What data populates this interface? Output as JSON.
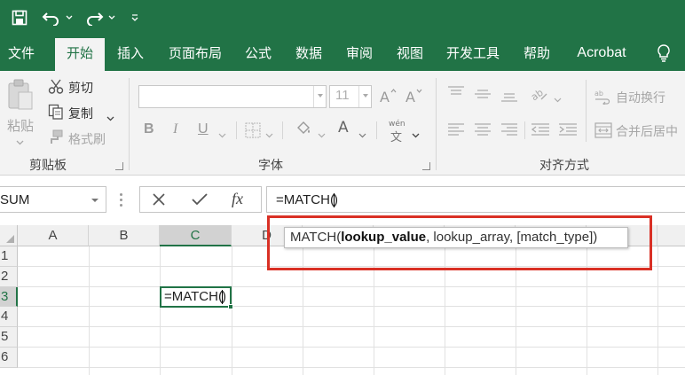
{
  "quick_access": {
    "save": "save-icon",
    "undo": "undo-icon",
    "redo": "redo-icon",
    "customize": "customize-icon"
  },
  "tabs": [
    {
      "label": "文件",
      "active": false
    },
    {
      "label": "开始",
      "active": true
    },
    {
      "label": "插入",
      "active": false
    },
    {
      "label": "页面布局",
      "active": false
    },
    {
      "label": "公式",
      "active": false
    },
    {
      "label": "数据",
      "active": false
    },
    {
      "label": "审阅",
      "active": false
    },
    {
      "label": "视图",
      "active": false
    },
    {
      "label": "开发工具",
      "active": false
    },
    {
      "label": "帮助",
      "active": false
    },
    {
      "label": "Acrobat",
      "active": false
    }
  ],
  "tell_me_icon": "lightbulb-icon",
  "clipboard": {
    "paste_label": "粘贴",
    "cut_label": "剪切",
    "copy_label": "复制",
    "format_painter_label": "格式刷",
    "group_label": "剪贴板"
  },
  "font": {
    "font_name": "",
    "font_size": "11",
    "bold": "B",
    "italic": "I",
    "underline": "U",
    "font_color_letter": "A",
    "phonetic_top": "wén",
    "phonetic_bottom": "文",
    "group_label": "字体"
  },
  "alignment": {
    "wrap_text_label": "自动换行",
    "merge_label": "合并后居中",
    "group_label": "对齐方式"
  },
  "formula_bar": {
    "name_box": "SUM",
    "cancel_icon": "close-icon",
    "enter_icon": "check-icon",
    "fx_label": "fx",
    "formula_before_cursor": "=MATCH(",
    "formula_after_cursor": ")"
  },
  "grid": {
    "columns": [
      "A",
      "B",
      "C",
      "D"
    ],
    "selected_column": "C",
    "rows": [
      "1",
      "2",
      "3",
      "4",
      "5",
      "6"
    ],
    "selected_row": "3",
    "active_cell_before_cursor": "=MATCH(",
    "active_cell_after_cursor": ")"
  },
  "tooltip": {
    "function_name": "MATCH(",
    "current_arg": "lookup_value",
    "rest_args": ", lookup_array, [match_type])"
  },
  "colors": {
    "brand": "#217346",
    "highlight": "#d93025"
  }
}
